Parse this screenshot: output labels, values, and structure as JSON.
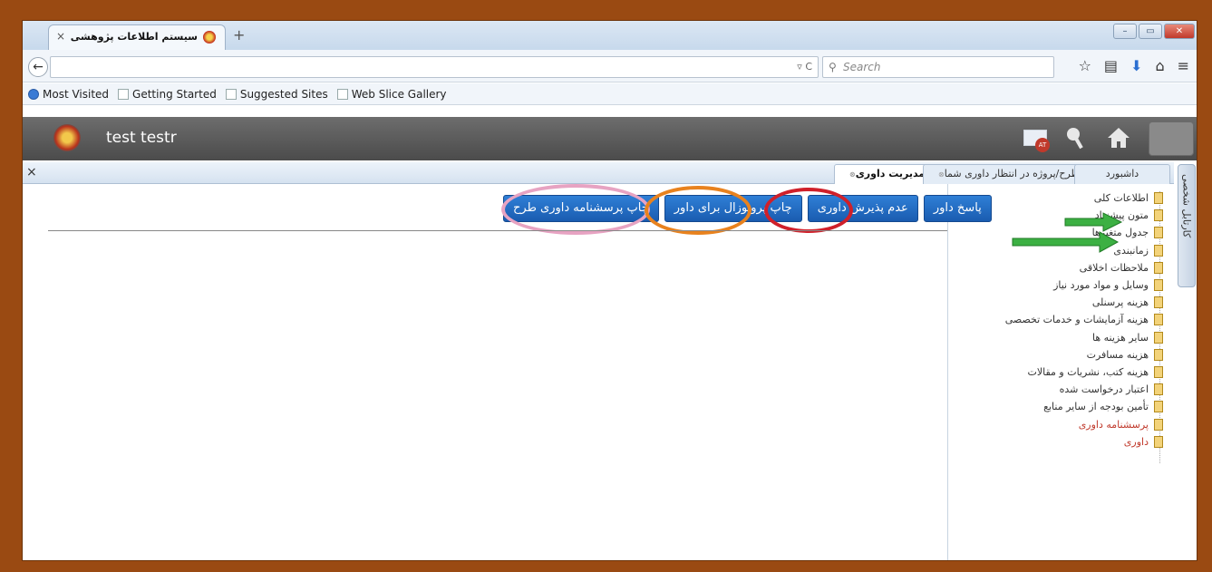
{
  "browser": {
    "tab_title": "سیستم اطلاعات پژوهشی",
    "tab_close": "×",
    "new_tab": "+",
    "search_placeholder": "Search",
    "search_icon": "search-icon",
    "reload_icon": "reload-icon",
    "bookmarks": [
      "Most Visited",
      "Getting Started",
      "Suggested Sites",
      "Web Slice Gallery"
    ]
  },
  "app": {
    "user_name": "test testr",
    "mail_badge": "AT"
  },
  "tabs": [
    {
      "label": "داشبورد"
    },
    {
      "label": "طرح/پروژه در انتظار داوری شما"
    },
    {
      "label": "مدیریت داوری"
    }
  ],
  "vertical_tab": "کارتابل شخصی",
  "tree_items": [
    "اطلاعات کلی",
    "متون پیشنهاد",
    "جدول متغیرها",
    "زمانبندی",
    "ملاحظات اخلاقی",
    "وسایل و مواد مورد نیاز",
    "هزینه پرسنلی",
    "هزینه آزمایشات و خدمات تخصصی",
    "سایر هزینه ها",
    "هزینه مسافرت",
    "هزینه کتب، نشریات و مقالات",
    "اعتبار درخواست شده",
    "تأمین بودجه از سایر منابع",
    "پرسشنامه داوری",
    "داوری"
  ],
  "actions": {
    "answer": "پاسخ داور",
    "reject": "عدم پذیرش داوری",
    "print_proposal": "چاپ پروپوزال برای داور",
    "print_questionnaire": "چاپ پرسشنامه داوری طرح"
  },
  "colors": {
    "frame": "#9a4a12",
    "header": "#5a5a5a",
    "button": "#1f6cc4",
    "ring_red": "#d0202a",
    "ring_orange": "#e8821e",
    "ring_pink": "#e7a3c2",
    "arrow_green": "#3cb043"
  }
}
